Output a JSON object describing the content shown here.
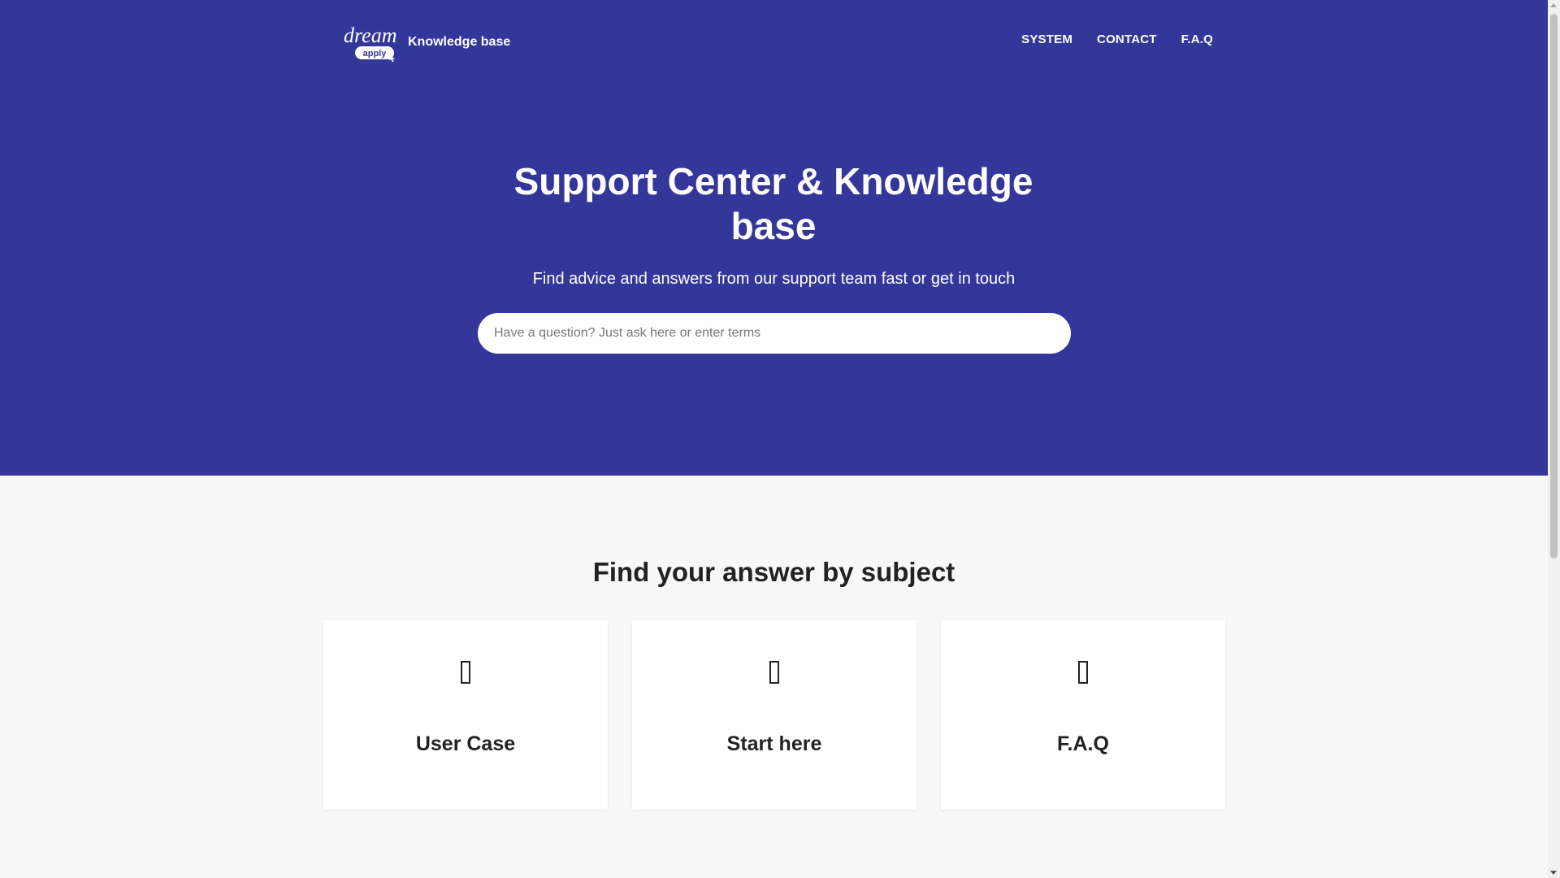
{
  "header": {
    "logo_text": "dream",
    "logo_sub": "apply",
    "brand_label": "Knowledge base",
    "nav": [
      {
        "label": "SYSTEM"
      },
      {
        "label": "CONTACT"
      },
      {
        "label": "F.A.Q"
      }
    ]
  },
  "hero": {
    "title": "Support Center & Knowledge base",
    "subtitle": "Find advice and answers from our support team fast or get in touch",
    "search_placeholder": "Have a question? Just ask here or enter terms"
  },
  "subjects": {
    "title": "Find your answer by subject",
    "cards": [
      {
        "label": "User Case",
        "icon": "missing-glyph-icon"
      },
      {
        "label": "Start here",
        "icon": "missing-glyph-icon"
      },
      {
        "label": "F.A.Q",
        "icon": "missing-glyph-icon"
      }
    ]
  },
  "colors": {
    "hero_bg": "#343699",
    "page_bg": "#f8f8f9",
    "card_bg": "#ffffff",
    "text_dark": "#222222"
  }
}
